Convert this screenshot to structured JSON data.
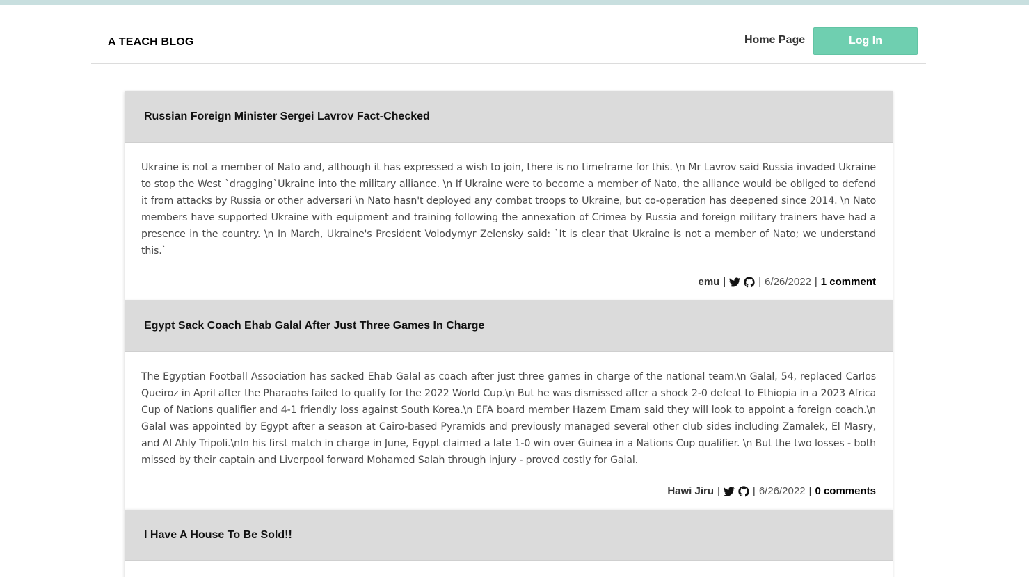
{
  "header": {
    "brand": "A TEACH BLOG",
    "nav_home": "Home Page",
    "nav_login": "Log In"
  },
  "posts": [
    {
      "title": "Russian Foreign Minister Sergei Lavrov Fact-Checked",
      "content": "Ukraine is not a member of Nato and, although it has expressed a wish to join, there is no timeframe for this. \\n Mr Lavrov said Russia invaded Ukraine to stop the West `dragging`Ukraine into the military alliance. \\n If Ukraine were to become a member of Nato, the alliance would be obliged to defend it from attacks by Russia or other adversari \\n Nato hasn't deployed any combat troops to Ukraine, but co-operation has deepened since 2014. \\n Nato members have supported Ukraine with equipment and training following the annexation of Crimea by Russia and foreign military trainers have had a presence in the country. \\n In March, Ukraine's President Volodymyr Zelensky said: `It is clear that Ukraine is not a member of Nato; we understand this.`",
      "author": "emu",
      "date": "6/26/2022",
      "comments": "1 comment"
    },
    {
      "title": "Egypt Sack Coach Ehab Galal After Just Three Games In Charge",
      "content": "The Egyptian Football Association has sacked Ehab Galal as coach after just three games in charge of the national team.\\n Galal, 54, replaced Carlos Queiroz in April after the Pharaohs failed to qualify for the 2022 World Cup.\\n But he was dismissed after a shock 2-0 defeat to Ethiopia in a 2023 Africa Cup of Nations qualifier and 4-1 friendly loss against South Korea.\\n EFA board member Hazem Emam said they will look to appoint a foreign coach.\\n Galal was appointed by Egypt after a season at Cairo-based Pyramids and previously managed several other club sides including Zamalek, El Masry, and Al Ahly Tripoli.\\nIn his first match in charge in June, Egypt claimed a late 1-0 win over Guinea in a Nations Cup qualifier. \\n But the two losses - both missed by their captain and Liverpool forward Mohamed Salah through injury - proved costly for Galal.",
      "author": "Hawi Jiru",
      "date": "6/26/2022",
      "comments": "0 comments"
    },
    {
      "title": "I Have A House To Be Sold!!"
    }
  ],
  "meta": {
    "separator": "|"
  },
  "icons": {
    "twitter": "twitter-icon",
    "github": "github-icon"
  },
  "colors": {
    "topbar": "#c8dfdf",
    "login_button": "#6fcfb0",
    "post_header": "#dbdbdb"
  }
}
